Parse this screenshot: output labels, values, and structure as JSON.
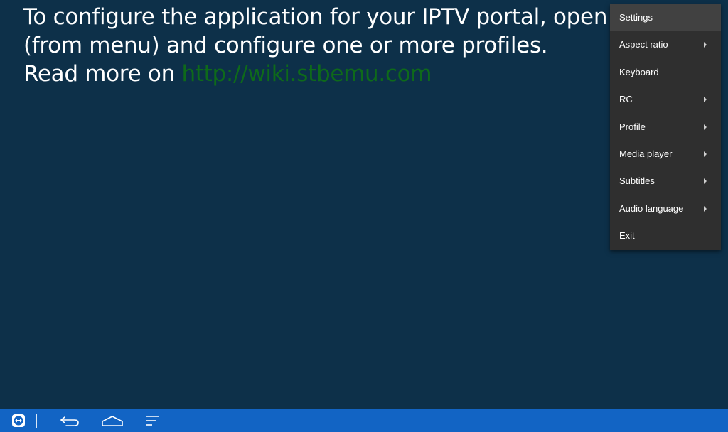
{
  "message": {
    "line1": "To configure the application for your IPTV portal, open",
    "line2": "(from menu) and configure one or more profiles.",
    "line3_prefix": "Read more on ",
    "link": "http://wiki.stbemu.com"
  },
  "menu": {
    "items": [
      {
        "label": "Settings",
        "has_submenu": false
      },
      {
        "label": "Aspect ratio",
        "has_submenu": true
      },
      {
        "label": "Keyboard",
        "has_submenu": false
      },
      {
        "label": "RC",
        "has_submenu": true
      },
      {
        "label": "Profile",
        "has_submenu": true
      },
      {
        "label": "Media player",
        "has_submenu": true
      },
      {
        "label": "Subtitles",
        "has_submenu": true
      },
      {
        "label": "Audio language",
        "has_submenu": true
      },
      {
        "label": "Exit",
        "has_submenu": false
      }
    ]
  },
  "navbar": {
    "buttons": [
      "teamviewer-icon",
      "back-icon",
      "home-icon",
      "recents-icon"
    ]
  },
  "colors": {
    "background": "#0d3049",
    "link": "#0e6a1a",
    "menu_bg": "#2f2f2f",
    "menu_highlight": "#414141",
    "navbar": "#1264c4"
  }
}
